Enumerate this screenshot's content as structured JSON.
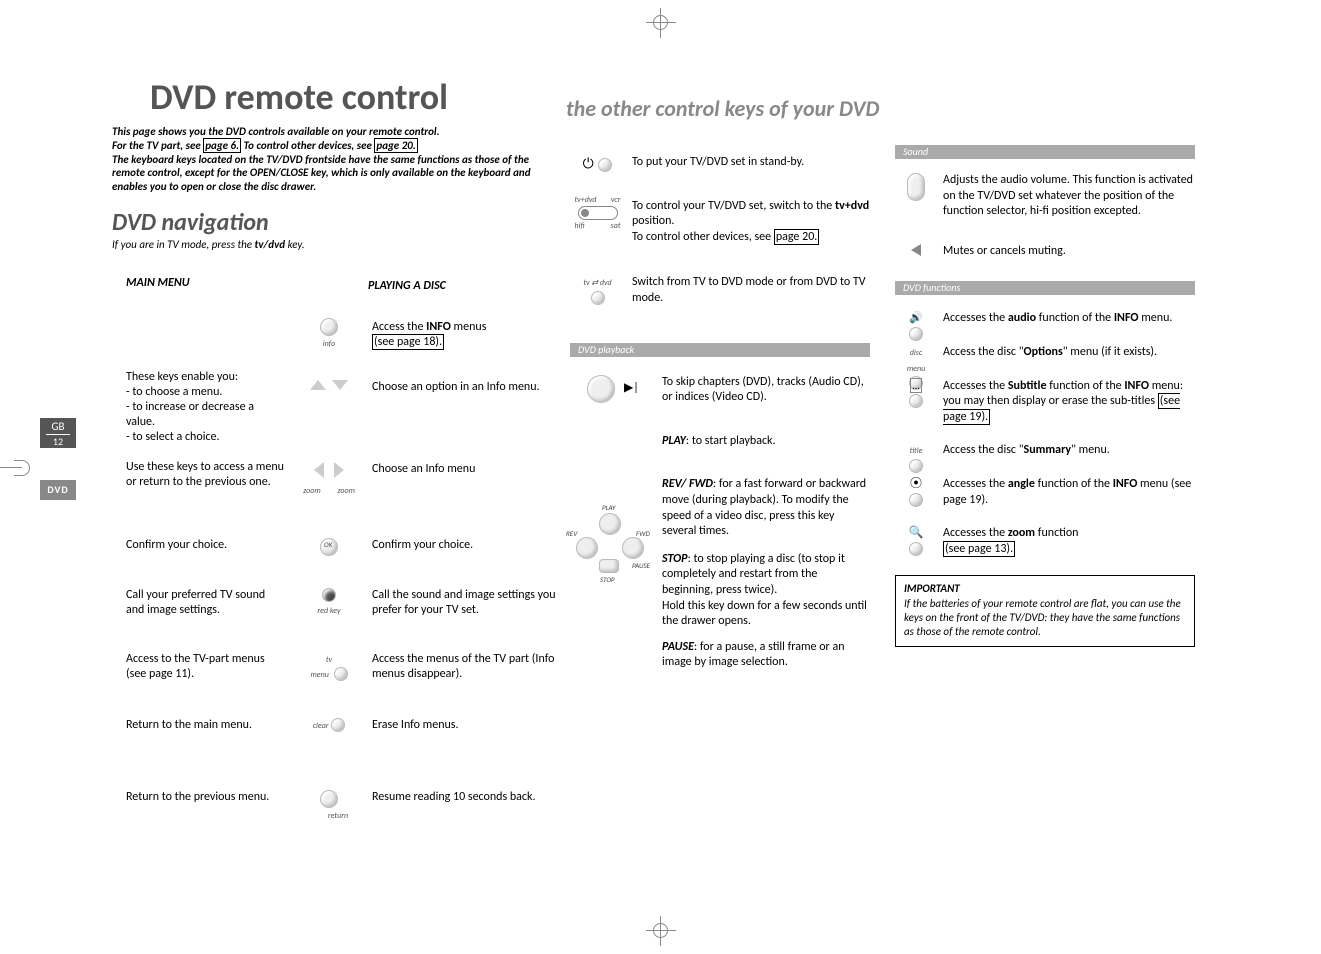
{
  "sideTab": {
    "gb": "GB",
    "gbPage": "12",
    "dvd": "DVD"
  },
  "header": {
    "title": "DVD remote control",
    "rightTitle": "the other control keys of your DVD"
  },
  "intro": {
    "l1a": "This page shows you the DVD controls available on your remote control.",
    "l2a": "For the TV part, see ",
    "l2link": "page 6.",
    "l2b": " To control other devices, see ",
    "l2link2": "page 20.",
    "l3": "The keyboard keys located on the TV/DVD frontside have the same functions as those of the remote control, except for the OPEN/CLOSE key, which is only available on the keyboard and enables you to open or close the disc drawer."
  },
  "dvdNav": {
    "h": "DVD navigation",
    "sub_a": "If you are in TV mode, press the ",
    "sub_b": "tv/dvd",
    "sub_c": " key."
  },
  "cols": {
    "main": "MAIN MENU",
    "play": "PLAYING A DISC"
  },
  "leftTable": {
    "r1": {
      "right_a": "Access the ",
      "right_bold": "INFO",
      "right_b": " menus ",
      "right_link": "(see page 18).",
      "iconLabel": "info"
    },
    "r2": {
      "left_intro": "These keys enable you:",
      "left_b1": "- to choose a menu.",
      "left_b2": "- to increase or decrease a value.",
      "left_b3": "- to select a choice.",
      "right": "Choose an option in an Info menu."
    },
    "r3": {
      "left": "Use these keys to access a menu or return to the previous one.",
      "right": "Choose an Info menu",
      "zoomL": "zoom",
      "zoomR": "zoom"
    },
    "r4": {
      "left": "Confirm your choice.",
      "right": "Confirm your choice.",
      "ok": "OK"
    },
    "r5": {
      "left": "Call your preferred TV sound and image settings.",
      "right": "Call the sound and image settings you prefer for your TV set.",
      "redkey": "red key"
    },
    "r6": {
      "left": "Access to the TV-part menus (see page 11).",
      "right": "Access the menus of the TV part (Info menus disappear).",
      "tvmenu1": "tv",
      "tvmenu2": "menu"
    },
    "r7": {
      "left": "Return to the main menu.",
      "right": "Erase Info menus.",
      "clear": "clear"
    },
    "r8": {
      "left": "Return to the previous menu.",
      "right": "Resume reading 10 seconds back.",
      "ret": "return"
    }
  },
  "mid": {
    "standby": "To put your TV/DVD set in stand-by.",
    "selector_a": "To control your TV/DVD set, switch to the ",
    "selector_bold": "tv+dvd",
    "selector_b": " position.",
    "selector_c": "To control other devices, see ",
    "selector_link": "page 20.",
    "sel_tl": "tv+dvd",
    "sel_tr": "vcr",
    "sel_bl": "hifi",
    "sel_br": "sat",
    "tvdvd_a": "Switch from TV to DVD mode or from DVD to TV mode.",
    "tvdvd_lbl": "tv ⇄ dvd",
    "bar_playback": "DVD playback",
    "skip": "To skip chapters (DVD), tracks (Audio CD), or indices (Video CD).",
    "play_lead": "PLAY",
    "play_txt": ": to start playback.",
    "revfwd_lead": "REV/ FWD",
    "revfwd_txt": ": for a fast forward or backward move  (during playback). To modify the speed of a video disc, press this key several times.",
    "stop_lead": "STOP",
    "stop_txt": ": to stop playing a disc (to stop it completely and restart from the beginning, press twice).",
    "stop_txt2": "Hold this key down for a few seconds until the drawer opens.",
    "pause_lead": "PAUSE",
    "pause_txt": ": for a pause, a still frame or an image by image selection.",
    "cl_play": "PLAY",
    "cl_rev": "REV",
    "cl_fwd": "FWD",
    "cl_pause": "PAUSE",
    "cl_stop": "STOP"
  },
  "right": {
    "bar_sound": "Sound",
    "vol": "Adjusts the audio volume. This function is activated on the TV/DVD set whatever the position of the function selector, hi-fi position excepted.",
    "mute": "Mutes or cancels muting.",
    "bar_func": "DVD functions",
    "audio_a": "Accesses the ",
    "audio_bold": "audio",
    "audio_b": " function of the ",
    "audio_bold2": "INFO",
    "audio_c": " menu.",
    "optmenu_lbl1": "disc",
    "optmenu_lbl2": "menu",
    "opt_a": "Access the disc \"",
    "opt_bold": "Options",
    "opt_b": "\" menu (if it exists).",
    "sub_a": "Accesses the ",
    "sub_bold": "Subtitle",
    "sub_b": " function of the ",
    "sub_bold2": "INFO",
    "sub_c": " menu: you may then display or erase the sub-titles ",
    "sub_link": "(see page 19).",
    "title_lbl": "title",
    "summary_a": "Access the disc \"",
    "summary_bold": "Summary",
    "summary_b": "\" menu.",
    "angle_a": "Accesses the ",
    "angle_bold": "angle",
    "angle_b": " function of the ",
    "angle_bold2": "INFO",
    "angle_c": " menu (see page 19).",
    "zoom_a": "Accesses the ",
    "zoom_bold": "zoom",
    "zoom_b": " function ",
    "zoom_link": "(see page 13).",
    "imp_h": "IMPORTANT",
    "imp_t": "If the batteries of your remote control are flat, you can use the keys on the front of the TV/DVD: they have the same functions as those of the remote control."
  }
}
